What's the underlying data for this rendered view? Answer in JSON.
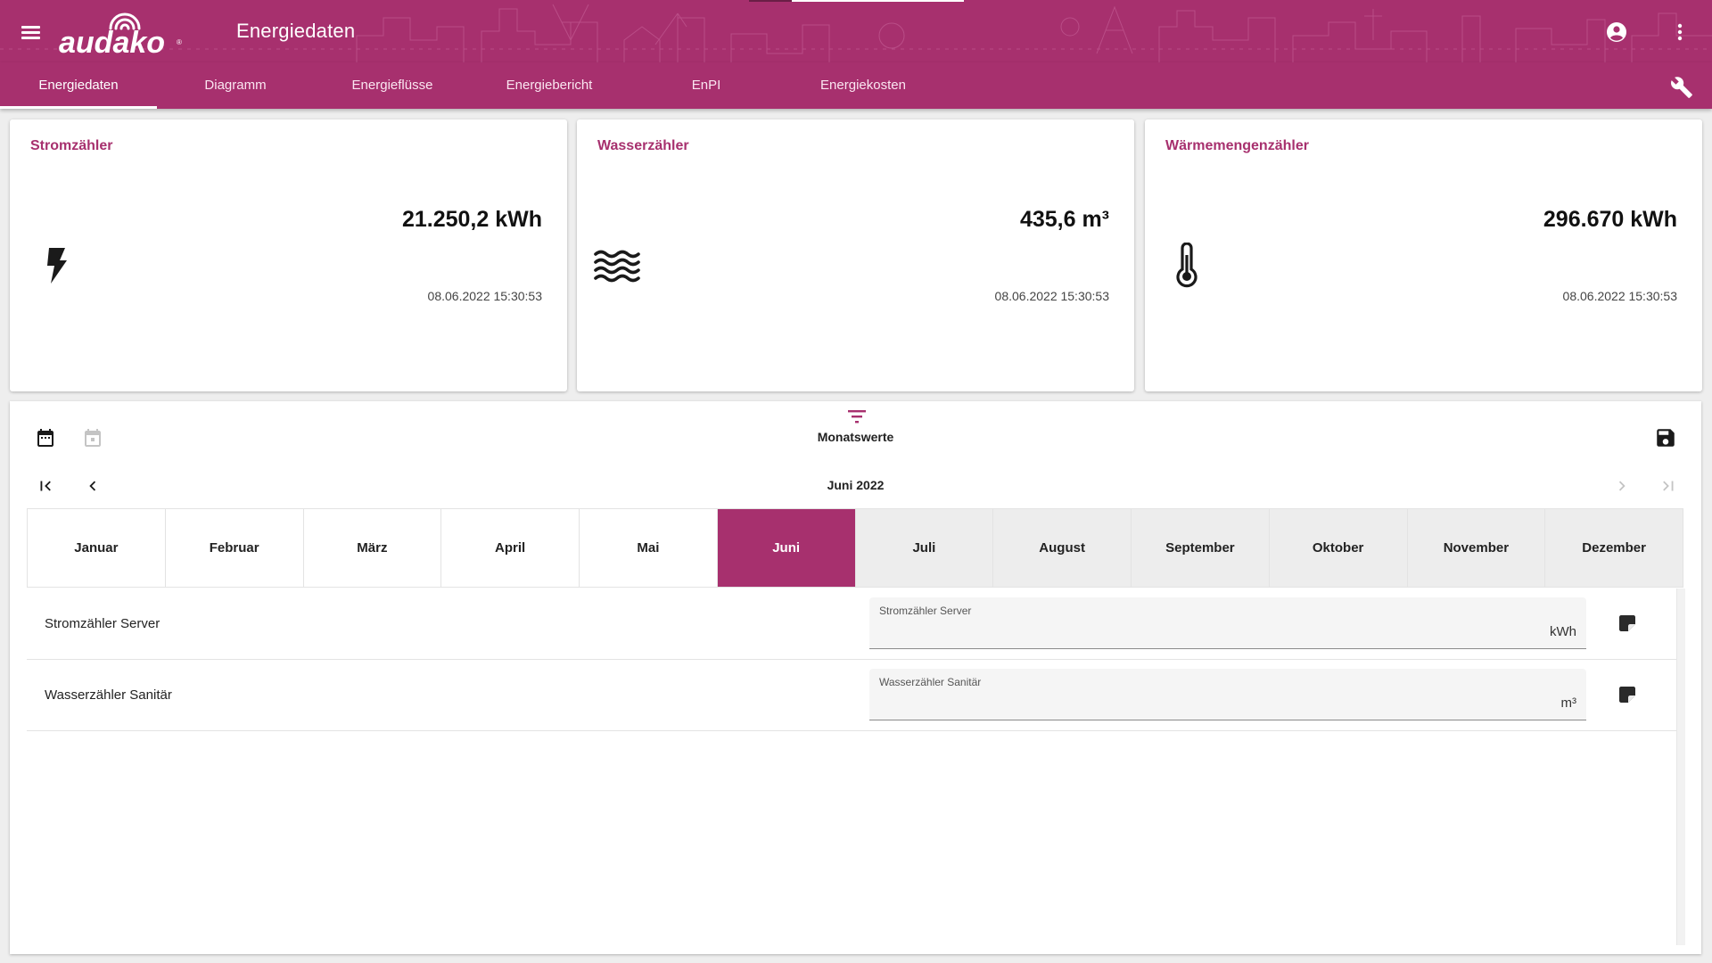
{
  "header": {
    "logo_text": "audako",
    "title": "Energiedaten"
  },
  "tabs": [
    {
      "label": "Energiedaten",
      "active": true
    },
    {
      "label": "Diagramm",
      "active": false
    },
    {
      "label": "Energieflüsse",
      "active": false
    },
    {
      "label": "Energiebericht",
      "active": false
    },
    {
      "label": "EnPI",
      "active": false
    },
    {
      "label": "Energiekosten",
      "active": false
    }
  ],
  "cards": [
    {
      "title": "Stromzähler",
      "value": "21.250,2 kWh",
      "timestamp": "08.06.2022  15:30:53",
      "icon": "lightning-icon"
    },
    {
      "title": "Wasserzähler",
      "value": "435,6 m³",
      "timestamp": "08.06.2022  15:30:53",
      "icon": "water-waves-icon"
    },
    {
      "title": "Wärmemengenzähler",
      "value": "296.670 kWh",
      "timestamp": "08.06.2022  15:30:53",
      "icon": "thermometer-icon"
    }
  ],
  "panel": {
    "mode_label": "Monatswerte",
    "period_label": "Juni 2022",
    "months": [
      "Januar",
      "Februar",
      "März",
      "April",
      "Mai",
      "Juni",
      "Juli",
      "August",
      "September",
      "Oktober",
      "November",
      "Dezember"
    ],
    "selected_month": "Juni",
    "rows": [
      {
        "label": "Stromzähler Server",
        "field_label": "Stromzähler Server",
        "unit": "kWh",
        "value": ""
      },
      {
        "label": "Wasserzähler Sanitär",
        "field_label": "Wasserzähler Sanitär",
        "unit": "m³",
        "value": ""
      }
    ]
  },
  "colors": {
    "brand": "#a7306e",
    "future_month_bg": "#ededed",
    "page_bg": "#eeeeee"
  }
}
